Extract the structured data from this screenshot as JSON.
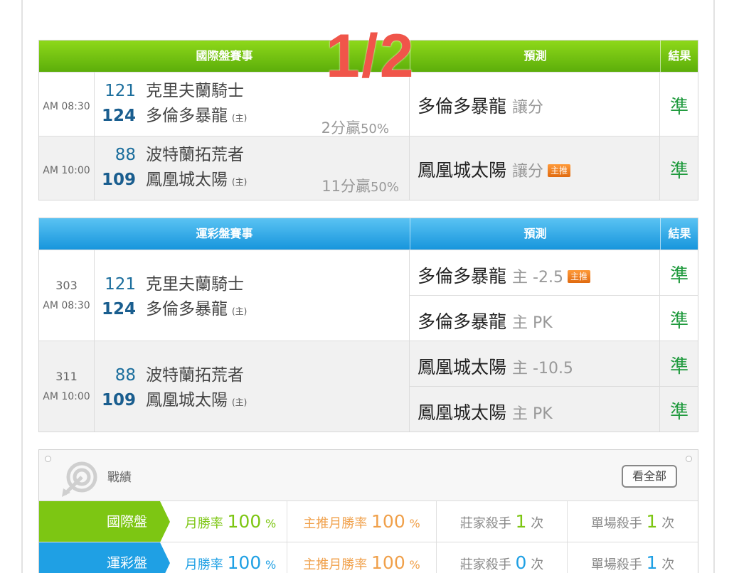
{
  "overlay_label": "1/2",
  "intl_table": {
    "header_match": "國際盤賽事",
    "header_predict": "預測",
    "header_result": "結果",
    "rows": [
      {
        "time": "AM 08:30",
        "away_num": "121",
        "away_name": "克里夫蘭騎士",
        "home_num": "124",
        "home_name": "多倫多暴龍",
        "home_tag": "(主)",
        "odds_text": "2分贏",
        "odds_pct": "50%",
        "pred_team": "多倫多暴龍",
        "pred_type": "讓分",
        "badge": "",
        "result": "準"
      },
      {
        "time": "AM 10:00",
        "away_num": "88",
        "away_name": "波特蘭拓荒者",
        "home_num": "109",
        "home_name": "鳳凰城太陽",
        "home_tag": "(主)",
        "odds_text": "11分贏",
        "odds_pct": "50%",
        "pred_team": "鳳凰城太陽",
        "pred_type": "讓分",
        "badge": "主推",
        "result": "準"
      }
    ]
  },
  "sport_table": {
    "header_match": "運彩盤賽事",
    "header_predict": "預測",
    "header_result": "結果",
    "rows": [
      {
        "code": "303",
        "time": "AM 08:30",
        "away_num": "121",
        "away_name": "克里夫蘭騎士",
        "home_num": "124",
        "home_name": "多倫多暴龍",
        "home_tag": "(主)",
        "preds": [
          {
            "team": "多倫多暴龍",
            "line": "主 -2.5",
            "badge": "主推",
            "result": "準"
          },
          {
            "team": "多倫多暴龍",
            "line": "主 PK",
            "badge": "",
            "result": "準"
          }
        ]
      },
      {
        "code": "311",
        "time": "AM 10:00",
        "away_num": "88",
        "away_name": "波特蘭拓荒者",
        "home_num": "109",
        "home_name": "鳳凰城太陽",
        "home_tag": "(主)",
        "preds": [
          {
            "team": "鳳凰城太陽",
            "line": "主 -10.5",
            "badge": "",
            "result": "準"
          },
          {
            "team": "鳳凰城太陽",
            "line": "主 PK",
            "badge": "",
            "result": "準"
          }
        ]
      }
    ]
  },
  "stats": {
    "title": "戰績",
    "view_all": "看全部",
    "rows": [
      {
        "label": "國際盤",
        "color": "#7dc613",
        "monthly_label": "月勝率",
        "monthly_value": "100",
        "pick_label": "主推月勝率",
        "pick_value": "100",
        "pct": "%",
        "house_label": "莊家殺手",
        "house_value": "1",
        "single_label": "單場殺手",
        "single_value": "1",
        "times": "次"
      },
      {
        "label": "運彩盤",
        "color": "#1fa0e4",
        "monthly_label": "月勝率",
        "monthly_value": "100",
        "pick_label": "主推月勝率",
        "pick_value": "100",
        "pct": "%",
        "house_label": "莊家殺手",
        "house_value": "0",
        "single_label": "單場殺手",
        "single_value": "1",
        "times": "次"
      }
    ]
  },
  "colors": {
    "green_header": "#6cc010",
    "blue_header": "#29a6e6",
    "result_green": "#1f9a3d",
    "badge_orange": "#f07d20",
    "team_number_blue": "#1a6d9c",
    "monthly_green": "#7dc613",
    "monthly_blue": "#1fa0e4",
    "pick_orange": "#f0a04a"
  }
}
